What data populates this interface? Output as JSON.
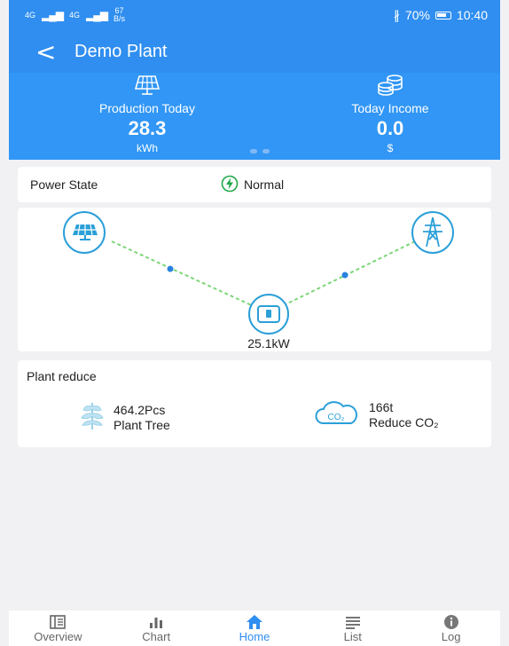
{
  "status_bar": {
    "network_a": "4G",
    "network_b": "4G",
    "speed_value": "67",
    "speed_unit": "B/s",
    "battery": "70%",
    "time": "10:40"
  },
  "header": {
    "back_icon": "chevron-left-icon",
    "title": "Demo Plant"
  },
  "summary": {
    "production": {
      "label": "Production Today",
      "value": "28.3",
      "unit": "kWh",
      "icon": "solar-panel-icon"
    },
    "income": {
      "label": "Today Income",
      "value": "0.0",
      "unit": "$",
      "icon": "coins-icon"
    },
    "page_dots": 2
  },
  "power_state": {
    "label": "Power State",
    "value": "Normal",
    "icon": "lightning-icon"
  },
  "flow": {
    "inverter_power": "25.1kW",
    "icons": [
      "solar-panel-icon",
      "inverter-icon",
      "power-tower-icon"
    ]
  },
  "plant_reduce": {
    "title": "Plant reduce",
    "tree": {
      "value": "464.2Pcs",
      "label": "Plant Tree",
      "icon": "tree-icon"
    },
    "co2": {
      "value": "166t",
      "label": "Reduce CO₂",
      "icon": "co2-cloud-icon"
    }
  },
  "tabs": [
    {
      "label": "Overview",
      "icon": "overview-icon"
    },
    {
      "label": "Chart",
      "icon": "bar-chart-icon"
    },
    {
      "label": "Home",
      "icon": "home-icon",
      "active": true
    },
    {
      "label": "List",
      "icon": "list-icon"
    },
    {
      "label": "Log",
      "icon": "info-icon"
    }
  ],
  "colors": {
    "brand_blue": "#2f8ef0",
    "flow_line": "#7ed67a",
    "icon_teal": "#2a9fd8"
  }
}
